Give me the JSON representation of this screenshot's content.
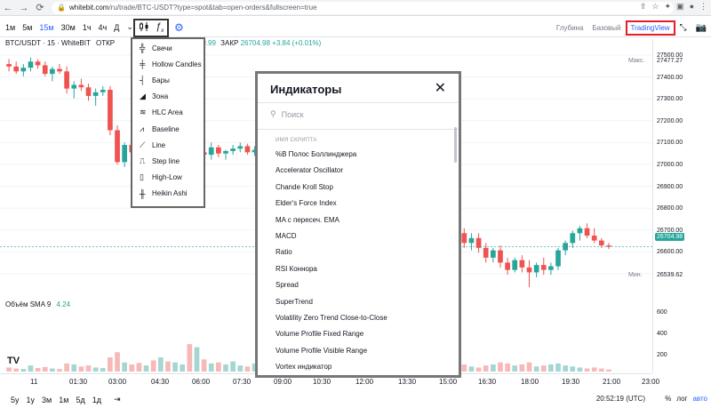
{
  "browser": {
    "url_host": "whitebit.com",
    "url_path": "/ru/trade/BTC-USDT?type=spot&tab=open-orders&fullscreen=true"
  },
  "toolbar": {
    "intervals": [
      "1м",
      "5м",
      "15м",
      "30м",
      "1ч",
      "4ч",
      "Д"
    ],
    "active_interval": "15м",
    "view_tabs": [
      "Глубина",
      "Базовый",
      "TradingView"
    ],
    "active_view": "TradingView"
  },
  "legend": {
    "symbol": "BTC/USDT · 15 · WhiteBIT",
    "open_label": "ОТКР",
    "open_partial": "26699.99",
    "close_label": "ЗАКР",
    "close_value": "26704.98",
    "change": "+3.84 (+0.01%)"
  },
  "price_axis": {
    "labels": [
      "27500.00",
      "27400.00",
      "27300.00",
      "27200.00",
      "27100.00",
      "27000.00",
      "26900.00",
      "26800.00",
      "26700.00",
      "26600.00",
      "26500.00"
    ],
    "high_label": "Макс.",
    "high_value": "27477.27",
    "last_value": "26704.98",
    "low_label": "Мин.",
    "low_value": "26539.62",
    "volume_labels": [
      "600",
      "400",
      "200"
    ]
  },
  "volume": {
    "label": "Объём SMA 9",
    "value": "4.24"
  },
  "time_axis": {
    "labels": [
      "11",
      "01:30",
      "03:00",
      "04:30",
      "06:00",
      "07:30",
      "09:00",
      "10:30",
      "12:00",
      "13:30",
      "15:00",
      "16:30",
      "18:00",
      "19:30",
      "21:00",
      "23:00"
    ]
  },
  "bottom": {
    "ranges": [
      "5у",
      "1у",
      "3м",
      "1м",
      "5д",
      "1д"
    ],
    "clock": "20:52:19 (UTC)",
    "options": [
      "%",
      "лог",
      "авто"
    ],
    "active_option": "авто"
  },
  "chart_menu": {
    "items": [
      {
        "label": "Свечи",
        "icon": "candles-icon"
      },
      {
        "label": "Hollow Candles",
        "icon": "hollow-candles-icon"
      },
      {
        "label": "Бары",
        "icon": "bars-icon"
      },
      {
        "label": "Зона",
        "icon": "area-icon"
      },
      {
        "label": "HLC Area",
        "icon": "hlc-area-icon"
      },
      {
        "label": "Baseline",
        "icon": "baseline-icon"
      },
      {
        "label": "Line",
        "icon": "line-icon"
      },
      {
        "label": "Step line",
        "icon": "step-line-icon"
      },
      {
        "label": "High-Low",
        "icon": "high-low-icon"
      },
      {
        "label": "Heikin Ashi",
        "icon": "heikin-ashi-icon"
      }
    ]
  },
  "indicators_dialog": {
    "title": "Индикаторы",
    "search_placeholder": "Поиск",
    "section": "ИМЯ СКРИПТА",
    "items": [
      "%B Полос Боллинджера",
      "Accelerator Oscillator",
      "Chande Kroll Stop",
      "Elder's Force Index",
      "MA с пересеч. EMA",
      "MACD",
      "Ratio",
      "RSI Коннора",
      "Spread",
      "SuperTrend",
      "Volatility Zero Trend Close-to-Close",
      "Volume Profile Fixed Range",
      "Volume Profile Visible Range",
      "Vortex индикатор"
    ]
  },
  "colors": {
    "up": "#26a69a",
    "down": "#ef5350",
    "accent": "#2962ff",
    "highlight_border": "#e31e24"
  },
  "chart_data": {
    "type": "candlestick",
    "price_range": [
      26500,
      27530
    ],
    "candles": [
      [
        27450,
        27470,
        27420,
        27440
      ],
      [
        27440,
        27460,
        27410,
        27420
      ],
      [
        27420,
        27450,
        27400,
        27435
      ],
      [
        27435,
        27477,
        27420,
        27460
      ],
      [
        27460,
        27470,
        27430,
        27445
      ],
      [
        27445,
        27460,
        27400,
        27410
      ],
      [
        27410,
        27440,
        27380,
        27430
      ],
      [
        27430,
        27450,
        27410,
        27420
      ],
      [
        27420,
        27440,
        27330,
        27350
      ],
      [
        27350,
        27380,
        27310,
        27365
      ],
      [
        27365,
        27390,
        27340,
        27355
      ],
      [
        27355,
        27370,
        27300,
        27320
      ],
      [
        27320,
        27350,
        27280,
        27335
      ],
      [
        27335,
        27360,
        27320,
        27345
      ],
      [
        27345,
        27360,
        27160,
        27180
      ],
      [
        27180,
        27200,
        27040,
        27050
      ],
      [
        27050,
        27130,
        27030,
        27120
      ],
      [
        27120,
        27140,
        27070,
        27090
      ],
      [
        27090,
        27110,
        27020,
        27040
      ],
      [
        27040,
        27080,
        27000,
        27060
      ],
      [
        27060,
        27090,
        26980,
        27010
      ],
      [
        27010,
        27150,
        27000,
        27130
      ],
      [
        27130,
        27140,
        27060,
        27080
      ],
      [
        27080,
        27120,
        27050,
        27100
      ],
      [
        27100,
        27140,
        27080,
        27120
      ],
      [
        27120,
        27135,
        27060,
        27075
      ],
      [
        27075,
        27100,
        27040,
        27090
      ],
      [
        27090,
        27110,
        27070,
        27080
      ],
      [
        27080,
        27130,
        27060,
        27110
      ],
      [
        27110,
        27120,
        27070,
        27085
      ],
      [
        27085,
        27100,
        27060,
        27095
      ],
      [
        27095,
        27120,
        27080,
        27105
      ],
      [
        27105,
        27130,
        27090,
        27115
      ],
      [
        27115,
        27125,
        27080,
        27090
      ],
      [
        27090,
        27115,
        27075,
        27100
      ],
      [
        27100,
        27130,
        27090,
        27120
      ],
      [
        27120,
        27140,
        27095,
        27105
      ],
      [
        27105,
        27120,
        27085,
        27110
      ],
      [
        27110,
        27125,
        27095,
        27100
      ],
      [
        27100,
        27115,
        27080,
        27090
      ],
      [
        27090,
        27105,
        27070,
        27080
      ],
      [
        27080,
        27100,
        27060,
        27070
      ],
      [
        27070,
        27085,
        27040,
        27050
      ],
      [
        27050,
        27070,
        27030,
        27060
      ],
      [
        27060,
        27080,
        27040,
        27055
      ],
      [
        27055,
        27070,
        27030,
        27040
      ],
      [
        27040,
        27060,
        27020,
        27035
      ],
      [
        27035,
        27055,
        27010,
        27045
      ],
      [
        27045,
        27060,
        27020,
        27030
      ],
      [
        27030,
        27050,
        27000,
        27025
      ],
      [
        27025,
        27040,
        26980,
        26990
      ],
      [
        26990,
        27010,
        26960,
        26975
      ],
      [
        26975,
        26990,
        26940,
        26950
      ],
      [
        26950,
        26970,
        26920,
        26935
      ],
      [
        26935,
        26950,
        26900,
        26910
      ],
      [
        26910,
        26930,
        26880,
        26890
      ],
      [
        26890,
        26910,
        26860,
        26875
      ],
      [
        26875,
        26890,
        26840,
        26850
      ],
      [
        26850,
        26870,
        26820,
        26835
      ],
      [
        26835,
        26850,
        26800,
        26815
      ],
      [
        26815,
        26840,
        26790,
        26825
      ],
      [
        26825,
        26840,
        26780,
        26790
      ],
      [
        26790,
        26810,
        26740,
        26760
      ],
      [
        26760,
        26780,
        26700,
        26720
      ],
      [
        26720,
        26760,
        26690,
        26740
      ],
      [
        26740,
        26760,
        26680,
        26700
      ],
      [
        26700,
        26720,
        26640,
        26660
      ],
      [
        26660,
        26700,
        26640,
        26690
      ],
      [
        26690,
        26710,
        26620,
        26640
      ],
      [
        26640,
        26660,
        26590,
        26610
      ],
      [
        26610,
        26660,
        26600,
        26650
      ],
      [
        26650,
        26670,
        26600,
        26620
      ],
      [
        26620,
        26650,
        26540,
        26600
      ],
      [
        26600,
        26640,
        26580,
        26630
      ],
      [
        26630,
        26660,
        26590,
        26610
      ],
      [
        26610,
        26640,
        26590,
        26625
      ],
      [
        26625,
        26700,
        26610,
        26690
      ],
      [
        26690,
        26730,
        26670,
        26720
      ],
      [
        26720,
        26770,
        26700,
        26760
      ],
      [
        26760,
        26790,
        26730,
        26780
      ],
      [
        26780,
        26800,
        26740,
        26750
      ],
      [
        26750,
        26780,
        26720,
        26730
      ],
      [
        26730,
        26740,
        26700,
        26710
      ],
      [
        26710,
        26720,
        26695,
        26705
      ]
    ],
    "volumes": [
      40,
      30,
      25,
      60,
      35,
      45,
      30,
      25,
      80,
      70,
      50,
      60,
      40,
      35,
      140,
      190,
      90,
      70,
      85,
      60,
      110,
      140,
      100,
      90,
      70,
      270,
      240,
      120,
      80,
      90,
      70,
      100,
      60,
      50,
      80,
      70,
      90,
      60,
      70,
      80,
      50,
      60,
      40,
      50,
      60,
      40,
      70,
      50,
      60,
      80,
      50,
      40,
      30,
      60,
      40,
      50,
      30,
      70,
      40,
      60,
      50,
      40,
      60,
      70,
      50,
      40,
      60,
      70,
      90,
      80,
      60,
      70,
      90,
      50,
      60,
      70,
      80,
      60,
      50,
      40,
      30,
      40,
      30,
      20
    ]
  }
}
